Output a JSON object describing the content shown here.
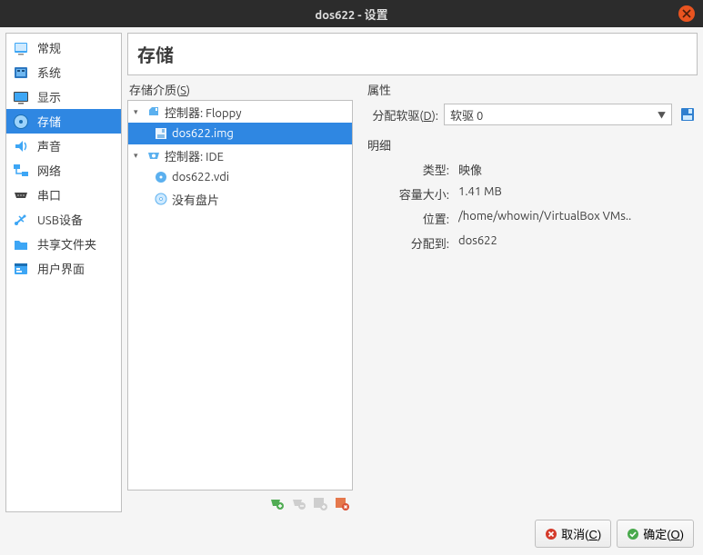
{
  "window": {
    "title": "dos622 - 设置"
  },
  "sidebar": {
    "items": [
      {
        "id": "general",
        "label": "常规",
        "icon": "general-icon"
      },
      {
        "id": "system",
        "label": "系统",
        "icon": "system-icon"
      },
      {
        "id": "display",
        "label": "显示",
        "icon": "display-icon"
      },
      {
        "id": "storage",
        "label": "存储",
        "icon": "storage-icon",
        "selected": true
      },
      {
        "id": "audio",
        "label": "声音",
        "icon": "audio-icon"
      },
      {
        "id": "network",
        "label": "网络",
        "icon": "network-icon"
      },
      {
        "id": "serial",
        "label": "串口",
        "icon": "serial-icon"
      },
      {
        "id": "usb",
        "label": "USB设备",
        "icon": "usb-icon"
      },
      {
        "id": "shared",
        "label": "共享文件夹",
        "icon": "shared-icon"
      },
      {
        "id": "ui",
        "label": "用户界面",
        "icon": "ui-icon"
      }
    ]
  },
  "header": {
    "title": "存储"
  },
  "storage_media": {
    "label_prefix": "存储介质(",
    "label_key": "S",
    "label_suffix": ")",
    "controllers": [
      {
        "name": "控制器: Floppy",
        "icon": "floppy-controller-icon",
        "children": [
          {
            "name": "dos622.img",
            "icon": "floppy-disk-icon",
            "selected": true
          }
        ]
      },
      {
        "name": "控制器: IDE",
        "icon": "ide-controller-icon",
        "children": [
          {
            "name": "dos622.vdi",
            "icon": "hdd-icon"
          },
          {
            "name": "没有盘片",
            "icon": "cd-icon"
          }
        ]
      }
    ],
    "toolbar": [
      {
        "id": "add-ctrl",
        "icon": "add-controller-icon",
        "enabled": true
      },
      {
        "id": "remove-ctrl",
        "icon": "remove-controller-icon",
        "enabled": false
      },
      {
        "id": "add-att",
        "icon": "add-attachment-icon",
        "enabled": false
      },
      {
        "id": "remove-att",
        "icon": "remove-attachment-icon",
        "enabled": true
      }
    ]
  },
  "attributes": {
    "group_label": "属性",
    "drive_label_prefix": "分配软驱(",
    "drive_label_key": "D",
    "drive_label_suffix": "):",
    "drive_value": "软驱 0"
  },
  "details": {
    "group_label": "明细",
    "rows": [
      {
        "k": "类型:",
        "v": "映像"
      },
      {
        "k": "容量大小:",
        "v": "1.41 MB"
      },
      {
        "k": "位置:",
        "v": "/home/whowin/VirtualBox VMs.."
      },
      {
        "k": "分配到:",
        "v": "dos622"
      }
    ]
  },
  "footer": {
    "cancel_prefix": "取消(",
    "cancel_key": "C",
    "cancel_suffix": ")",
    "ok_prefix": "确定(",
    "ok_key": "O",
    "ok_suffix": ")"
  }
}
